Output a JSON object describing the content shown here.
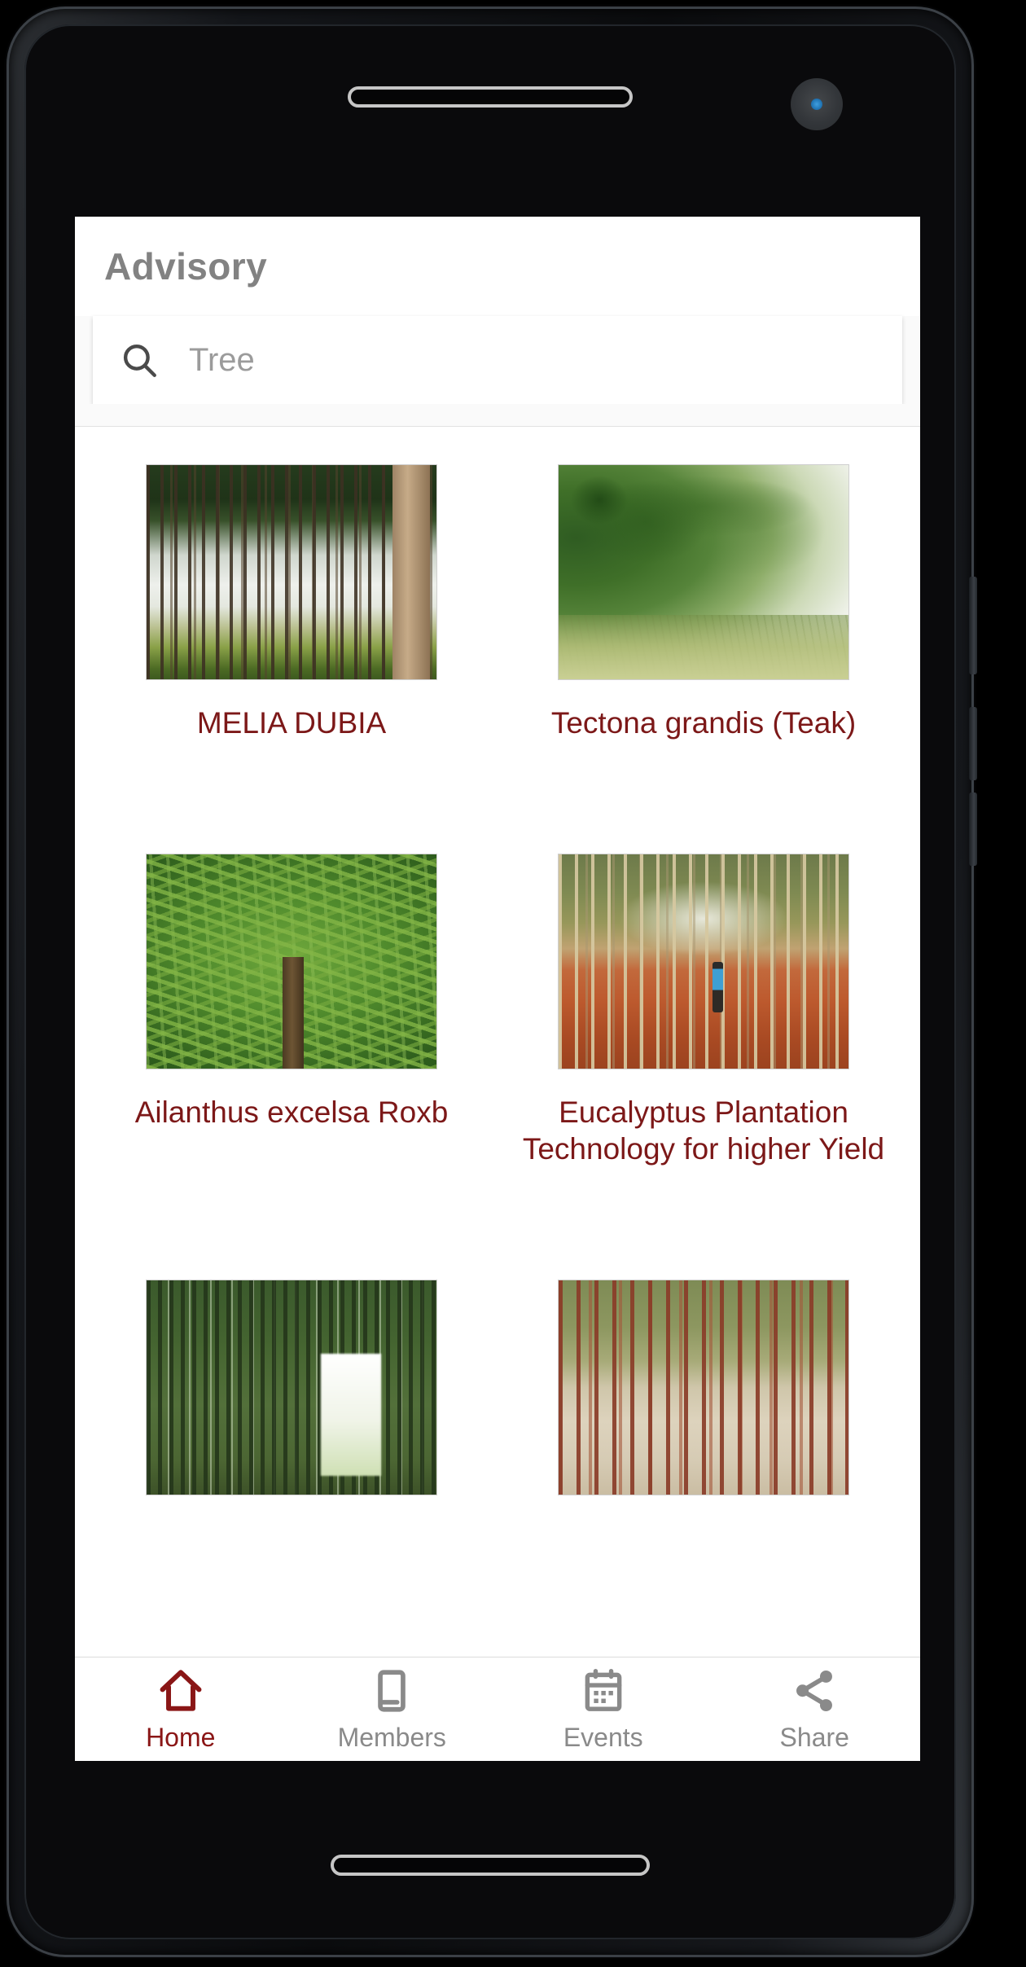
{
  "device": {
    "earpiece_name": "earpiece-speaker",
    "camera_name": "front-camera",
    "home_pill_name": "home-indicator-pill"
  },
  "header": {
    "title": "Advisory"
  },
  "search": {
    "placeholder": "Tree",
    "value": "",
    "icon": "search-icon"
  },
  "theme": {
    "accent": "#8a1616",
    "card_label_color": "#7c1818",
    "title_color": "#828282",
    "nav_inactive_color": "#8a8a8a",
    "screen_bg": "#ffffff"
  },
  "grid": {
    "cards": [
      {
        "label": "MELIA DUBIA",
        "art": "art-melia",
        "name": "card-melia-dubia"
      },
      {
        "label": "Tectona grandis (Teak)",
        "art": "art-teak",
        "name": "card-tectona-grandis"
      },
      {
        "label": "Ailanthus excelsa Roxb",
        "art": "art-ailanthus",
        "name": "card-ailanthus-excelsa"
      },
      {
        "label": "Eucalyptus Plantation Technology for higher Yield",
        "art": "art-eucalyptus",
        "name": "card-eucalyptus-plantation"
      },
      {
        "label": "",
        "art": "art-corridor",
        "name": "card-row3-left"
      },
      {
        "label": "",
        "art": "art-redtrunks",
        "name": "card-row3-right"
      }
    ]
  },
  "bottom_nav": {
    "items": [
      {
        "label": "Home",
        "icon": "home-icon",
        "active": true
      },
      {
        "label": "Members",
        "icon": "book-icon",
        "active": false
      },
      {
        "label": "Events",
        "icon": "calendar-icon",
        "active": false
      },
      {
        "label": "Share",
        "icon": "share-icon",
        "active": false
      }
    ]
  }
}
